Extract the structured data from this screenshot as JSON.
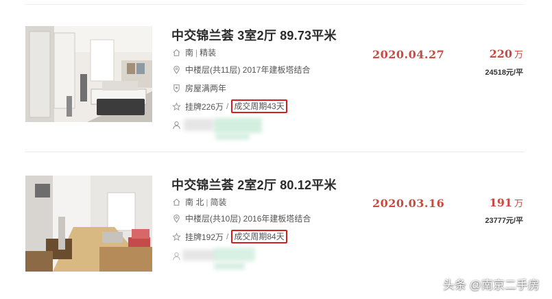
{
  "listings": [
    {
      "title": "中交锦兰荟 3室2厅 89.73平米",
      "orientation": "南",
      "decoration": "精装",
      "floor_info": "中楼层(共11层) 2017年建板塔结合",
      "tag": "房屋满两年",
      "listing_price": "挂牌226万",
      "deal_cycle": "成交周期43天",
      "date": "2020.04.27",
      "price": "220",
      "price_unit": "万",
      "unit_price": "24518元/平"
    },
    {
      "title": "中交锦兰荟 2室2厅 80.12平米",
      "orientation": "南 北",
      "decoration": "简装",
      "floor_info": "中楼层(共10层) 2016年建板塔结合",
      "listing_price": "挂牌192万",
      "deal_cycle": "成交周期84天",
      "date": "2020.03.16",
      "price": "191",
      "price_unit": "万",
      "unit_price": "23777元/平"
    }
  ],
  "watermark": "头条 @南京二手房",
  "colors": {
    "accent": "#c94a40",
    "highlight_box": "#d22020"
  },
  "icons": [
    "home-icon",
    "location-icon",
    "shield-icon",
    "star-icon",
    "user-icon"
  ]
}
